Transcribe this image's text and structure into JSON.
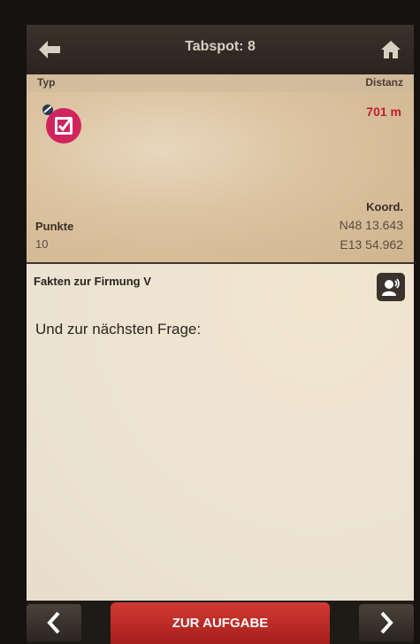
{
  "header": {
    "title": "Tabspot: 8",
    "back_icon": "arrow-left-icon",
    "home_icon": "home-icon"
  },
  "info": {
    "typ_label": "Typ",
    "distanz_label": "Distanz",
    "distance_value": "701 m",
    "punkte_label": "Punkte",
    "punkte_value": "10",
    "koord_label": "Koord.",
    "koord_n": "N48 13.643",
    "koord_e": "E13 54.962",
    "type_icon": "checkbox-task-icon"
  },
  "content": {
    "fact_title": "Fakten zur Firmung V",
    "question_text": "Und zur nächsten Frage:",
    "audio_icon": "speaker-person-icon"
  },
  "footer": {
    "task_button_label": "ZUR AUFGABE",
    "prev_icon": "chevron-left-icon",
    "next_icon": "chevron-right-icon"
  },
  "colors": {
    "accent_red": "#c0202c",
    "dark_bar": "#2a241f"
  }
}
